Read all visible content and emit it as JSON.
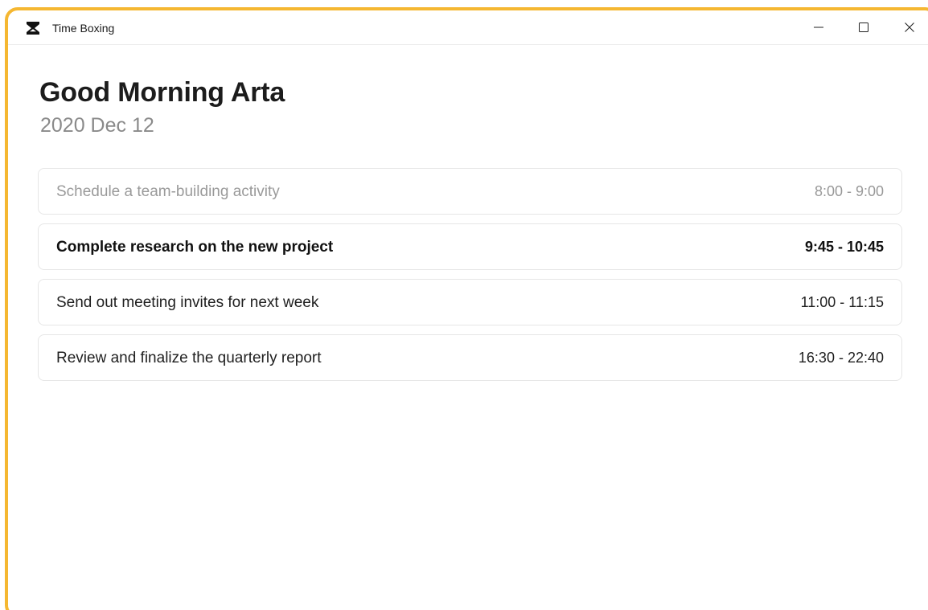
{
  "window": {
    "title": "Time Boxing",
    "accent_color": "#f5b731"
  },
  "window_controls": {
    "minimize_icon": "minimize-icon",
    "maximize_icon": "maximize-icon",
    "close_icon": "close-icon"
  },
  "header": {
    "greeting": "Good Morning Arta",
    "date": "2020 Dec 12"
  },
  "tasks": [
    {
      "title": "Schedule a team-building activity",
      "time": "8:00 - 9:00",
      "state": "done"
    },
    {
      "title": "Complete research on the new project",
      "time": "9:45 - 10:45",
      "state": "current"
    },
    {
      "title": "Send out meeting invites for next week",
      "time": "11:00 - 11:15",
      "state": "upcoming"
    },
    {
      "title": "Review and finalize the quarterly report",
      "time": "16:30 - 22:40",
      "state": "upcoming"
    }
  ]
}
